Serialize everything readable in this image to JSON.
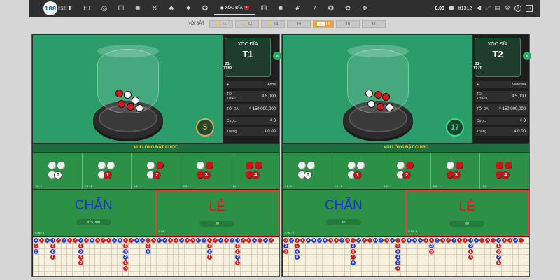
{
  "brand": {
    "logo_text": "188BET"
  },
  "topbar": {
    "active_game": {
      "label": "XÓC ĐĨA",
      "badge": "•"
    },
    "balance": "0.00",
    "username": "tt1312"
  },
  "featured": {
    "label": "NỔI BẬT",
    "tabs": [
      {
        "label": "T1",
        "bolt": true,
        "active": false
      },
      {
        "label": "T2",
        "bolt": true,
        "active": false
      },
      {
        "label": "T3",
        "bolt": true,
        "active": false
      },
      {
        "label": "T4",
        "bolt": false,
        "active": false
      },
      {
        "label": "T5",
        "bolt": false,
        "active": true,
        "new": "NEW"
      },
      {
        "label": "T6",
        "bolt": false,
        "active": false
      },
      {
        "label": "T7",
        "bolt": false,
        "active": false
      }
    ]
  },
  "tables": [
    {
      "game": "XÓC ĐĨA",
      "table_id": "T1",
      "round": "01-1182",
      "dealer": "Anne",
      "min_label": "TỐI THIỂU.",
      "min_value": "₫ 5,000",
      "max_label": "TỐI ĐA.",
      "max_value": "₫ 150,000,000",
      "bet_label": "Cược.",
      "bet_value": "₫ 0",
      "win_label": "Thắng.",
      "win_value": "₫ 0.00",
      "timer": "5",
      "banner": "VUI LÒNG ĐẶT CƯỢC",
      "bets": [
        {
          "odds": "14 : 1",
          "num": "0"
        },
        {
          "odds": "2.8 : 1",
          "num": "1"
        },
        {
          "odds": "1.6 : 1",
          "num": "2"
        },
        {
          "odds": "2.8 : 1",
          "num": "3"
        },
        {
          "odds": "14 : 1",
          "num": "4"
        }
      ],
      "even": {
        "label": "CHẴN",
        "amount": "₫75,000",
        "odds": "0.96 : 1"
      },
      "odd": {
        "label": "LẺ",
        "amount": "₫0",
        "odds": "0.96 : 1"
      }
    },
    {
      "game": "XÓC ĐĨA",
      "table_id": "T2",
      "round": "02-1170",
      "dealer": "Vanessa",
      "min_label": "TỐI THIỂU.",
      "min_value": "₫ 5,000",
      "max_label": "TỐI ĐA.",
      "max_value": "₫ 150,000,000",
      "bet_label": "Cược.",
      "bet_value": "₫ 0",
      "win_label": "Thắng.",
      "win_value": "₫ 0.00",
      "timer": "17",
      "banner": "VUI LÒNG ĐẶT CƯỢC",
      "bets": [
        {
          "odds": "14 : 1",
          "num": "0"
        },
        {
          "odds": "2.8 : 1",
          "num": "1"
        },
        {
          "odds": "1.6 : 1",
          "num": "2"
        },
        {
          "odds": "2.8 : 1",
          "num": "3"
        },
        {
          "odds": "14 : 1",
          "num": "4"
        }
      ],
      "even": {
        "label": "CHẴN",
        "amount": "₫0",
        "odds": "0.96 : 1"
      },
      "odd": {
        "label": "LẺ",
        "amount": "₫0",
        "odds": "0.96 : 1"
      }
    }
  ],
  "roads": [
    [
      [
        "4",
        "b"
      ],
      [
        "1",
        "r"
      ],
      [
        "2",
        "b"
      ],
      [
        "0",
        "b"
      ],
      [
        "3",
        "r"
      ],
      [
        "2",
        "b"
      ],
      [
        "1",
        "r"
      ],
      [
        "3",
        "r"
      ],
      [
        "2",
        "b"
      ],
      [
        "1",
        "r"
      ],
      [
        "0",
        "b"
      ],
      [
        "3",
        "r"
      ],
      [
        "3",
        "r"
      ],
      [
        "1",
        "r"
      ],
      [
        "2",
        "b"
      ],
      [
        "0",
        "b"
      ],
      [
        "1",
        "r"
      ],
      [
        "3",
        "r"
      ],
      [
        "4",
        "b"
      ],
      [
        "2",
        "b"
      ],
      [
        "1",
        "r"
      ],
      [
        "3",
        "r"
      ],
      [
        "0",
        "b"
      ],
      [
        "2",
        "b"
      ],
      [
        "1",
        "r"
      ],
      [
        "3",
        "r"
      ],
      [
        "2",
        "b"
      ],
      [
        "1",
        "r"
      ],
      [
        "3",
        "r"
      ],
      [
        "0",
        "b"
      ],
      [
        "2",
        "b"
      ],
      [
        "1",
        "r"
      ],
      [
        "3",
        "r"
      ],
      [
        "2",
        "b"
      ],
      [
        "1",
        "r"
      ],
      [
        "2",
        "b"
      ],
      [
        "0",
        "b"
      ],
      [
        "3",
        "r"
      ],
      [
        "1",
        "r"
      ],
      [
        "2",
        "b"
      ],
      [
        "1",
        "r"
      ],
      [
        "2",
        "b"
      ],
      [
        "3",
        "r"
      ]
    ],
    [
      [
        "3",
        "r"
      ],
      [
        "2",
        "b"
      ],
      [
        "3",
        "r"
      ],
      [
        "1",
        "r"
      ],
      [
        "4",
        "b"
      ],
      [
        "0",
        "b"
      ],
      [
        "2",
        "b"
      ],
      [
        "0",
        "b"
      ],
      [
        "3",
        "r"
      ],
      [
        "1",
        "r"
      ],
      [
        "2",
        "b"
      ],
      [
        "3",
        "r"
      ],
      [
        "1",
        "r"
      ],
      [
        "2",
        "b"
      ],
      [
        "3",
        "r"
      ],
      [
        "1",
        "r"
      ],
      [
        "0",
        "b"
      ],
      [
        "2",
        "b"
      ],
      [
        "3",
        "r"
      ],
      [
        "2",
        "b"
      ],
      [
        "1",
        "r"
      ],
      [
        "3",
        "r"
      ],
      [
        "0",
        "b"
      ],
      [
        "4",
        "b"
      ],
      [
        "2",
        "b"
      ],
      [
        "3",
        "r"
      ],
      [
        "1",
        "r"
      ],
      [
        "2",
        "b"
      ],
      [
        "3",
        "r"
      ],
      [
        "3",
        "r"
      ],
      [
        "2",
        "b"
      ],
      [
        "1",
        "r"
      ],
      [
        "3",
        "r"
      ],
      [
        "0",
        "b"
      ],
      [
        "2",
        "b"
      ],
      [
        "1",
        "r"
      ],
      [
        "3",
        "r"
      ],
      [
        "1",
        "r"
      ],
      [
        "2",
        "b"
      ],
      [
        "1",
        "r"
      ],
      [
        "3",
        "r"
      ],
      [
        "2",
        "b"
      ],
      [
        "1",
        "r"
      ]
    ]
  ]
}
